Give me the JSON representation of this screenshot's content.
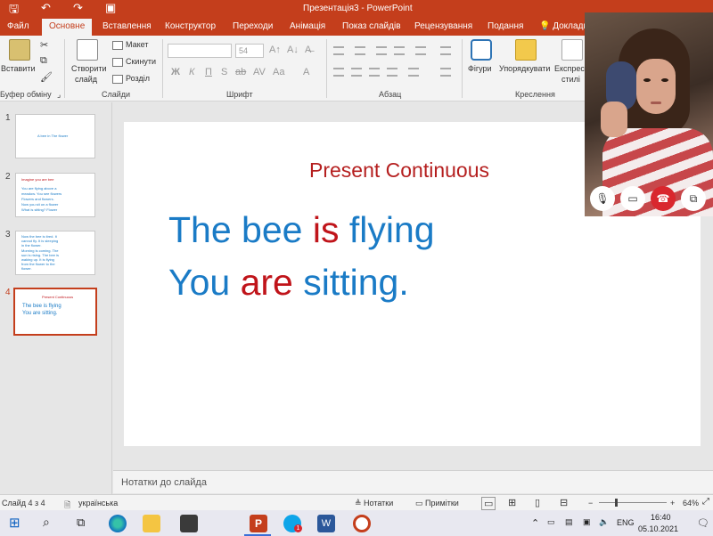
{
  "window": {
    "title": "Презентація3 - PowerPoint"
  },
  "tabs": [
    {
      "label": "Файл"
    },
    {
      "label": "Основне"
    },
    {
      "label": "Вставлення"
    },
    {
      "label": "Конструктор"
    },
    {
      "label": "Переходи"
    },
    {
      "label": "Анімація"
    },
    {
      "label": "Показ слайдів"
    },
    {
      "label": "Рецензування"
    },
    {
      "label": "Подання"
    },
    {
      "label": "Докладн"
    }
  ],
  "ribbon": {
    "paste_label": "Вставити",
    "clipboard_group": "Буфер обміну",
    "new_slide_line1": "Створити",
    "new_slide_line2": "слайд",
    "layout_label": "Макет",
    "reset_label": "Скинути",
    "section_label": "Розділ",
    "slides_group": "Слайди",
    "font_size_value": "54",
    "font_group": "Шрифт",
    "paragraph_group": "Абзац",
    "shapes_label": "Фігури",
    "arrange_label": "Упорядкувати",
    "quick_styles_line1": "Експрес",
    "quick_styles_line2": "стилі",
    "drawing_group": "Креслення",
    "bold": "Ж",
    "italic": "К",
    "underline": "П",
    "strike": "S",
    "shadow": "ab",
    "spacing": "AV",
    "case": "Aa",
    "clear": "A"
  },
  "thumbnails": [
    {
      "num": "1",
      "lines": [
        {
          "text": "A bee in The flower",
          "color": "#1a7bc6"
        }
      ]
    },
    {
      "num": "2",
      "lines": [
        {
          "text": "Imagine you are bee",
          "color": "#c0141a"
        },
        {
          "text": "You are flying above a",
          "color": "#1a7bc6"
        },
        {
          "text": "meadow. You see flowers",
          "color": "#1a7bc6"
        },
        {
          "text": "Flowers and flowers.",
          "color": "#1a7bc6"
        },
        {
          "text": "Now you sit on a flower",
          "color": "#1a7bc6"
        },
        {
          "text": "What is sitting? Flower",
          "color": "#1a7bc6"
        }
      ]
    },
    {
      "num": "3",
      "lines": [
        {
          "text": "Now the bee is tired. It",
          "color": "#1a7bc6"
        },
        {
          "text": "cannot fly. It is sleeping",
          "color": "#1a7bc6"
        },
        {
          "text": "in the flower.",
          "color": "#1a7bc6"
        },
        {
          "text": "Morning is coming. The",
          "color": "#1a7bc6"
        },
        {
          "text": "sun is rising. The bee is",
          "color": "#1a7bc6"
        },
        {
          "text": "waking up. It is flying",
          "color": "#1a7bc6"
        },
        {
          "text": "from the flower to the",
          "color": "#1a7bc6"
        },
        {
          "text": "flower.",
          "color": "#1a7bc6"
        }
      ]
    },
    {
      "num": "4",
      "lines": [
        {
          "text": "Present Continuous",
          "color": "#c0141a"
        },
        {
          "text": "The bee is flying",
          "color": "#1a7bc6"
        },
        {
          "text": "You are sitting.",
          "color": "#1a7bc6"
        }
      ]
    }
  ],
  "slide": {
    "title": "Present Continuous",
    "line1": {
      "subject": "The bee ",
      "verb": "is",
      "rest": " flying"
    },
    "line2": {
      "subject": "You ",
      "verb": "are",
      "rest": " sitting",
      "punct": "."
    }
  },
  "notes_placeholder": "Нотатки до слайда",
  "status": {
    "slide_info": "Слайд 4 з 4",
    "language": "українська",
    "notes_btn": "Нотатки",
    "comments_btn": "Примітки",
    "zoom": "64%"
  },
  "taskbar": {
    "lang": "ENG",
    "time": "16:40",
    "date": "05.10.2021",
    "pp_badge": "P",
    "skype_badge": "1"
  },
  "colors": {
    "accent": "#c43e1c",
    "slide_blue": "#1a7bc6",
    "slide_red": "#c0141a"
  }
}
